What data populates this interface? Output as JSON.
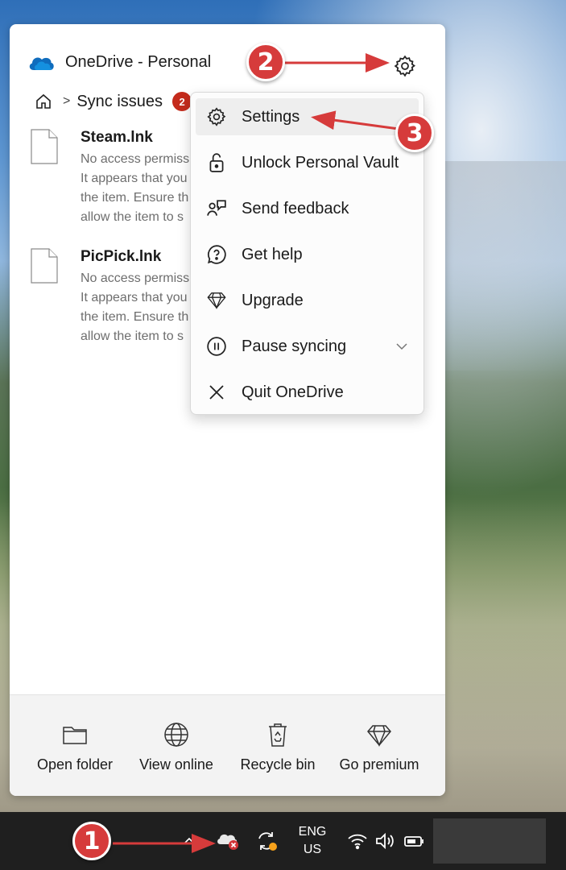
{
  "app": {
    "title": "OneDrive - Personal"
  },
  "breadcrumb": {
    "current": "Sync issues",
    "badge_count": "2"
  },
  "files": [
    {
      "name": "Steam.lnk",
      "desc_lines": [
        "No access permiss",
        "It appears that you",
        "the item. Ensure th",
        "allow the item to s"
      ]
    },
    {
      "name": "PicPick.lnk",
      "desc_lines": [
        "No access permiss",
        "It appears that you",
        "the item. Ensure th",
        "allow the item to s"
      ]
    }
  ],
  "menu": {
    "items": [
      {
        "label": "Settings",
        "icon": "gear-icon"
      },
      {
        "label": "Unlock Personal Vault",
        "icon": "unlock-icon"
      },
      {
        "label": "Send feedback",
        "icon": "feedback-icon"
      },
      {
        "label": "Get help",
        "icon": "help-icon"
      },
      {
        "label": "Upgrade",
        "icon": "diamond-icon"
      },
      {
        "label": "Pause syncing",
        "icon": "pause-icon"
      },
      {
        "label": "Quit OneDrive",
        "icon": "close-icon"
      }
    ]
  },
  "footer": {
    "buttons": [
      {
        "label": "Open folder",
        "icon": "folder-icon"
      },
      {
        "label": "View online",
        "icon": "globe-icon"
      },
      {
        "label": "Recycle bin",
        "icon": "recycle-bin-icon"
      },
      {
        "label": "Go premium",
        "icon": "diamond-icon"
      }
    ]
  },
  "taskbar": {
    "lang_line1": "ENG",
    "lang_line2": "US"
  },
  "annotations": [
    "1",
    "2",
    "3"
  ],
  "colors": {
    "onedrive_blue": "#0f6cbd",
    "badge_red": "#c42b1c",
    "annotation_red": "#d63b3b"
  }
}
